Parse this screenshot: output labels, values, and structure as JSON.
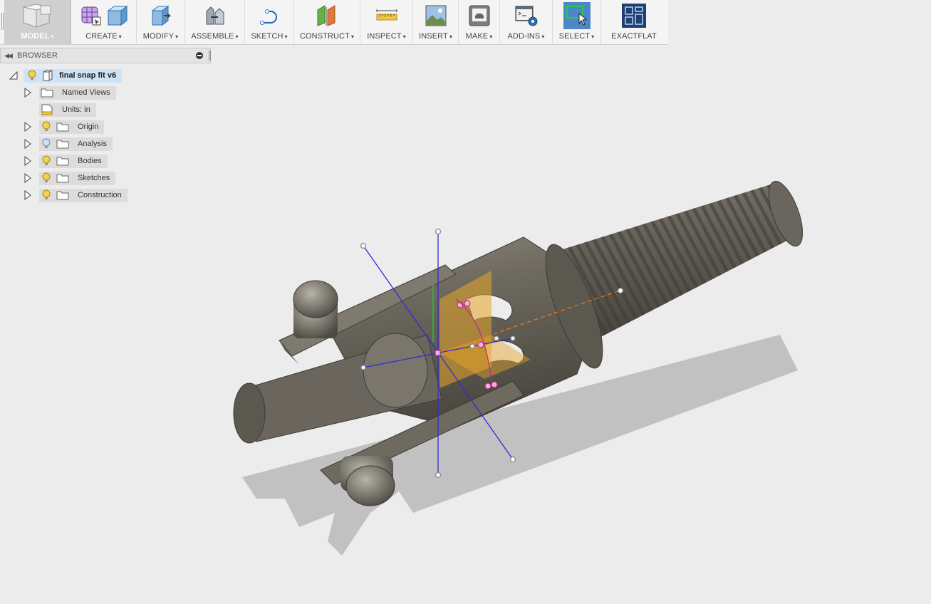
{
  "toolbar": {
    "groups": [
      {
        "label": "MODEL",
        "icon": "model-workspace-icon"
      },
      {
        "label": "CREATE",
        "icon": "create-icon"
      },
      {
        "label": "MODIFY",
        "icon": "modify-icon"
      },
      {
        "label": "ASSEMBLE",
        "icon": "assemble-icon"
      },
      {
        "label": "SKETCH",
        "icon": "sketch-icon"
      },
      {
        "label": "CONSTRUCT",
        "icon": "construct-icon"
      },
      {
        "label": "INSPECT",
        "icon": "inspect-icon"
      },
      {
        "label": "INSERT",
        "icon": "insert-icon"
      },
      {
        "label": "MAKE",
        "icon": "make-icon"
      },
      {
        "label": "ADD-INS",
        "icon": "add-ins-icon"
      },
      {
        "label": "SELECT",
        "icon": "select-icon"
      },
      {
        "label": "EXACTFLAT",
        "icon": "exactflat-icon"
      }
    ],
    "caret": "▾"
  },
  "browser": {
    "title": "BROWSER",
    "root": {
      "label": "final snap fit v6"
    },
    "items": [
      {
        "label": "Named Views"
      },
      {
        "label": "Units: in"
      },
      {
        "label": "Origin"
      },
      {
        "label": "Analysis"
      },
      {
        "label": "Bodies"
      },
      {
        "label": "Sketches"
      },
      {
        "label": "Construction"
      }
    ]
  },
  "colors": {
    "bulb": "#f2d44b",
    "bulb_off": "#9cc5e8",
    "accent_blue": "#1f5f9e",
    "axis_blue": "#2d2dd6",
    "section_orange": "#e8a628",
    "model_metal": "#6e6a60"
  }
}
